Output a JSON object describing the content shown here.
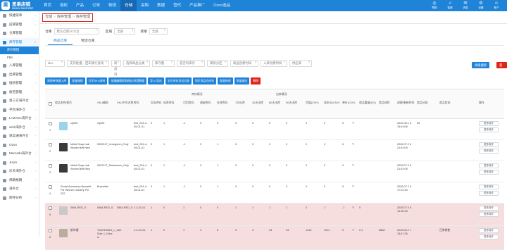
{
  "app": {
    "logo_text": "思果店铺",
    "logo_sub": "SIGUO SHOP ERP",
    "logo_glyph": "果"
  },
  "topnav": [
    "首页",
    "授权",
    "产品",
    "订单",
    "物流",
    "仓储",
    "采购",
    "数据",
    "营代",
    "产品推广",
    "Ozon选品"
  ],
  "topnav_active": 5,
  "topicons": [
    {
      "glyph": "◎",
      "label": "帮助"
    },
    {
      "glyph": "♫",
      "label": "客服"
    },
    {
      "glyph": "✉",
      "label": "消息"
    },
    {
      "glyph": "⚙",
      "label": "设置"
    },
    {
      "glyph": "☺",
      "label": "账户"
    }
  ],
  "sidebar": {
    "items": [
      {
        "label": "快捷菜单",
        "icon": "star-icon"
      },
      {
        "label": "店铺管理",
        "icon": "store-icon"
      },
      {
        "label": "仓库管理",
        "icon": "warehouse-icon"
      },
      {
        "label": "库存管理",
        "icon": "inventory-icon",
        "open": true
      },
      {
        "label": "入库管理",
        "icon": "inbound-icon"
      },
      {
        "label": "出库管理",
        "icon": "outbound-icon"
      },
      {
        "label": "描绘管理",
        "icon": "draw-icon"
      },
      {
        "label": "质检管理",
        "icon": "check-icon"
      },
      {
        "label": "第三方海外仓",
        "icon": "globe-icon"
      },
      {
        "label": "平台海外仓",
        "icon": "cloud-icon"
      },
      {
        "label": "LAZADA海外仓",
        "icon": "box-icon"
      },
      {
        "label": "wish海外仓",
        "icon": "gift-icon"
      },
      {
        "label": "速卖通海外仓",
        "icon": "plane-icon"
      },
      {
        "label": "Ozon",
        "icon": "o-icon"
      },
      {
        "label": "Mercado海外仓",
        "icon": "m-icon"
      },
      {
        "label": "Joom",
        "icon": "j-icon"
      },
      {
        "label": "乐天海外仓",
        "icon": "r-icon"
      },
      {
        "label": "佛朗格朗",
        "icon": "f-icon"
      },
      {
        "label": "海外仓",
        "icon": "ship-icon"
      },
      {
        "label": "库存分析",
        "icon": "chart-icon"
      }
    ],
    "sub_items": [
      "库存管理",
      "FBA"
    ],
    "sub_active": 0
  },
  "breadcrumb": [
    "仓储",
    "库存管理",
    "库存管理"
  ],
  "filters": {
    "warehouse_label": "仓库",
    "warehouse_value": "默认仓库/义乌仓",
    "region_label": "区域",
    "region_value": "全部",
    "inventory_label": "货架",
    "inventory_value": "全部"
  },
  "tabs": [
    "商品仓库",
    "物流仓库"
  ],
  "tab_active": 0,
  "search": {
    "fields": [
      "sku",
      "支持批量，回车换行查询",
      "商品列",
      "选择商品分类",
      "库存量",
      "是否有库存",
      "库龄分区",
      "商品创建时间",
      "入库创建时间",
      "供应商"
    ],
    "primary_button": "高级搜索",
    "reset_button": "重置"
  },
  "actions": [
    "采购单快速入库",
    "批量调拨",
    "打印SKU条码",
    "批量编辑采购建议/库容数据",
    "导入/导出",
    "全仓库存导出记录",
    "同步商品仓库存",
    "批量修改",
    "批量调出"
  ],
  "action_red": "删除",
  "table": {
    "group_headers": [
      "库存情况",
      "出库情况"
    ],
    "headers": [
      "商品名称/图片",
      "SKU编码",
      "SKU中文名称",
      "库位",
      "实际库存",
      "标签库存",
      "可用库存",
      "调配库存",
      "在途库存",
      "7天出库",
      "30天出库",
      "60天出库",
      "90天出库",
      "货值(CNY)",
      "成本价(CNY)",
      "单价(CNY)",
      "商品重量(KG)",
      "商品体积",
      "创建/更新时间",
      "商品分组",
      "商品状态",
      "操作"
    ],
    "rows": [
      {
        "name": "rzj005",
        "sku": "rzj005",
        "sku_cn": "",
        "loc": "test_001-4-45-01-01",
        "actual": "0",
        "label": "1",
        "avail": "-1",
        "alloc": "0",
        "transit": "0",
        "d7": "0",
        "d30": "0",
        "d60": "0",
        "d90": "0",
        "value": "0",
        "cost": "0",
        "price": "0",
        "weight": "",
        "volume": "",
        "time": "2022.05.1 6 15:43:06",
        "group": "69",
        "status": "",
        "pink": false,
        "thumb": "spray-bottles"
      },
      {
        "name": "Metal Snap-hair Woven Belt New",
        "sku": "0302117_Limegreen_Only",
        "sku_cn": "",
        "loc": "test_001-4-45-01-01",
        "actual": "0",
        "label": "1",
        "avail": "-1",
        "alloc": "0",
        "transit": "1",
        "d7": "0",
        "d30": "0",
        "d60": "0",
        "d90": "0",
        "value": "0",
        "cost": "0",
        "price": "0",
        "weight": "",
        "volume": "",
        "time": "2026.07.2 6 21:42:09",
        "group": "",
        "status": "",
        "pink": false,
        "thumb": "belt"
      },
      {
        "name": "Metal Snap-hair Woven Belt New",
        "sku": "0302117_Darkbrown_Only",
        "sku_cn": "",
        "loc": "test_001-4-45-01-01",
        "actual": "0",
        "label": "1",
        "avail": "-1",
        "alloc": "0",
        "transit": "1",
        "d7": "0",
        "d30": "0",
        "d60": "0",
        "d90": "0",
        "value": "0",
        "cost": "0",
        "price": "0",
        "weight": "",
        "volume": "",
        "time": "2026.07.2 6 21:42:09",
        "group": "",
        "status": "",
        "pink": false,
        "thumb": "belt"
      },
      {
        "name": "Smart Accessory Bracelet For Women Jewelry For 222",
        "sku": "Bracelets",
        "sku_cn": "",
        "loc": "test_001-4-45-01-01",
        "actual": "0",
        "label": "1",
        "avail": "-1",
        "alloc": "0",
        "transit": "1",
        "d7": "0",
        "d30": "0",
        "d60": "0",
        "d90": "0",
        "value": "0",
        "cost": "0",
        "price": "0",
        "weight": "",
        "volume": "",
        "time": "2026.07.2 6 17:31:34",
        "group": "",
        "status": "",
        "pink": false,
        "thumb": "none"
      },
      {
        "name": "0564-RED_S",
        "sku": "0564-RED_S",
        "sku_cn": "0564-RED_S",
        "loc": "1-2-01-01",
        "actual": "1",
        "label": "0",
        "avail": "1",
        "alloc": "0",
        "transit": "0",
        "d7": "1",
        "d30": "1",
        "d60": "1",
        "d90": "1",
        "value": "0",
        "cost": "1",
        "price": "-1",
        "weight": "0",
        "volume": "",
        "time": "2026.07.0 6 14:35:33",
        "group": "",
        "status": "",
        "pink": true,
        "thumb": "shirt"
      },
      {
        "name": "帆布帽",
        "sku": "YASHEMAO_L_with Size: L Color: w",
        "sku_cn": "",
        "loc": "1-2-01-01",
        "actual": "1",
        "label": "0",
        "avail": "1",
        "alloc": "3",
        "transit": "8",
        "d7": "3",
        "d30": "3",
        "d60": "23",
        "d90": "23",
        "value": "1212",
        "cost": "1212",
        "price": "0",
        "weight": "0.1",
        "volume": "8888",
        "time": "2023.03.2 7 15:47:26",
        "group": "",
        "status": "正常销售",
        "pink": true,
        "thumb": "cap"
      }
    ],
    "op_more": "更多操作",
    "op_edit": "更多操作"
  },
  "colors": {
    "brand": "#1f84d8",
    "danger": "#e0241a",
    "row_highlight": "#f6dede"
  }
}
